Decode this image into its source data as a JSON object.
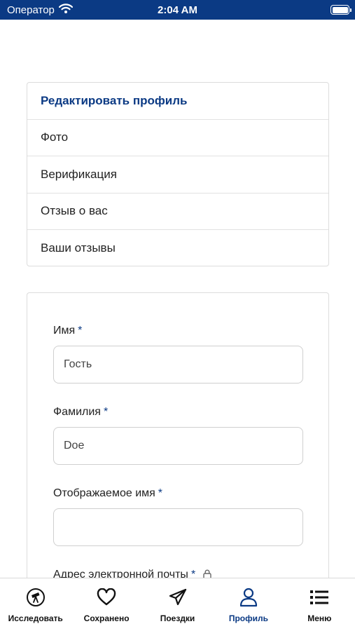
{
  "status_bar": {
    "carrier": "Оператор",
    "time": "2:04 AM"
  },
  "profile_menu": {
    "items": [
      {
        "label": "Редактировать профиль",
        "active": true
      },
      {
        "label": "Фото"
      },
      {
        "label": "Верификация"
      },
      {
        "label": "Отзыв о вас"
      },
      {
        "label": "Ваши отзывы"
      }
    ]
  },
  "form": {
    "required_marker": "*",
    "first_name": {
      "label": "Имя",
      "value": "Гость"
    },
    "last_name": {
      "label": "Фамилия",
      "value": "Doe"
    },
    "display_name": {
      "label": "Отображаемое имя",
      "value": ""
    },
    "email": {
      "label": "Адрес электронной почты"
    }
  },
  "tab_bar": {
    "tabs": [
      {
        "label": "Исследовать",
        "icon": "telescope-icon"
      },
      {
        "label": "Сохранено",
        "icon": "heart-icon"
      },
      {
        "label": "Поездки",
        "icon": "paper-plane-icon"
      },
      {
        "label": "Профиль",
        "icon": "user-icon",
        "active": true
      },
      {
        "label": "Меню",
        "icon": "list-icon"
      }
    ]
  },
  "colors": {
    "brand": "#0b3a84",
    "text": "#222222",
    "border": "#dcdcdc"
  }
}
